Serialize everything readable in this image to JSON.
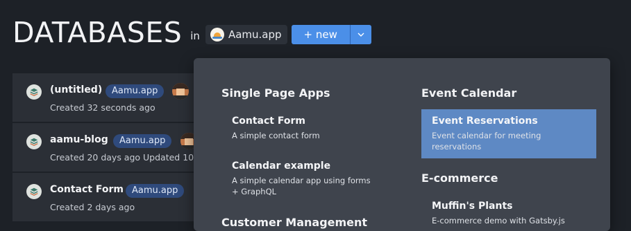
{
  "header": {
    "title": "DATABASES",
    "in_label": "in",
    "workspace": "Aamu.app",
    "new_button": "+ new"
  },
  "databases": [
    {
      "title": "(untitled)",
      "badge": "Aamu.app",
      "meta": "Created 32 seconds ago"
    },
    {
      "title": "aamu-blog",
      "badge": "Aamu.app",
      "meta": "Created 20 days ago    Updated 10"
    },
    {
      "title": "Contact Form",
      "badge": "Aamu.app",
      "meta": "Created 2 days ago"
    }
  ],
  "dropdown": {
    "groups_left": [
      {
        "title": "Single Page Apps",
        "items": [
          {
            "name": "Contact Form",
            "desc": "A simple contact form"
          },
          {
            "name": "Calendar example",
            "desc": "A simple calendar app using forms + GraphQL"
          }
        ]
      }
    ],
    "groups_right": [
      {
        "title": "Event Calendar",
        "items": [
          {
            "name": "Event Reservations",
            "desc": "Event calendar for meeting reservations",
            "active": true
          }
        ]
      },
      {
        "title": "E-commerce",
        "items": [
          {
            "name": "Muffin's Plants",
            "desc": "E-commerce demo with Gatsby.js"
          }
        ]
      }
    ],
    "partial_group_title": "Customer Management"
  },
  "colors": {
    "background": "#1d2127",
    "accent": "#4b8fe8",
    "active_item": "#5e89c4",
    "badge": "#2f4a7c",
    "dropdown": "#3f444d"
  }
}
